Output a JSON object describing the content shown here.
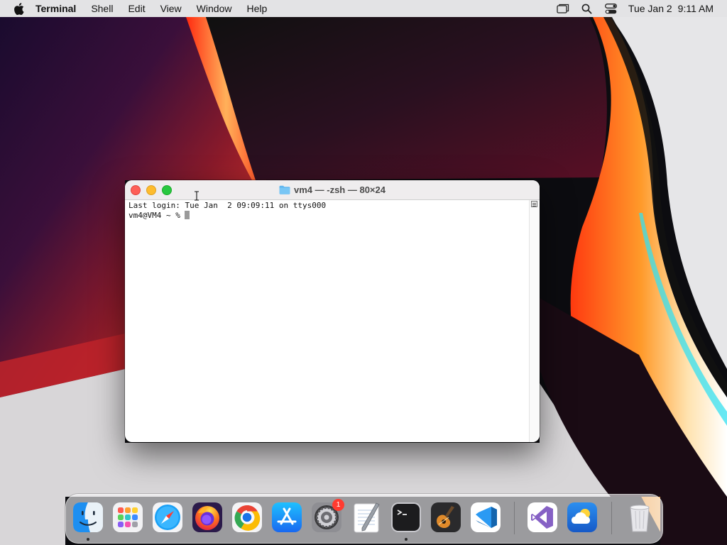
{
  "menubar": {
    "app_name": "Terminal",
    "menus": [
      "Shell",
      "Edit",
      "View",
      "Window",
      "Help"
    ],
    "status_icons": [
      "screen-mirroring-icon",
      "spotlight-search-icon",
      "control-center-icon"
    ],
    "date": "Tue Jan 2",
    "time": "9:11 AM"
  },
  "window": {
    "title": "vm4 — -zsh — 80×24",
    "lines": [
      "Last login: Tue Jan  2 09:09:11 on ttys000",
      "vm4@VM4 ~ % "
    ]
  },
  "dock": {
    "apps": [
      {
        "name": "Finder",
        "icon": "finder-icon",
        "running": true
      },
      {
        "name": "Launchpad",
        "icon": "launchpad-icon",
        "running": false
      },
      {
        "name": "Safari",
        "icon": "safari-icon",
        "running": false
      },
      {
        "name": "Firefox",
        "icon": "firefox-icon",
        "running": false
      },
      {
        "name": "Google Chrome",
        "icon": "chrome-icon",
        "running": false
      },
      {
        "name": "App Store",
        "icon": "app-store-icon",
        "running": false
      },
      {
        "name": "System Settings",
        "icon": "system-settings-icon",
        "running": false,
        "badge": "1"
      },
      {
        "name": "TextEdit",
        "icon": "textedit-icon",
        "running": false
      },
      {
        "name": "Terminal",
        "icon": "terminal-icon",
        "running": true
      },
      {
        "name": "GarageBand",
        "icon": "garageband-icon",
        "running": false
      },
      {
        "name": "Visual Studio Code",
        "icon": "vscode-icon",
        "running": false
      },
      {
        "name": "Visual Studio",
        "icon": "visual-studio-icon",
        "running": false
      },
      {
        "name": "Weather",
        "icon": "weather-icon",
        "running": false
      },
      {
        "name": "Trash",
        "icon": "trash-icon",
        "running": false
      }
    ]
  },
  "colors": {
    "close": "#fe5f57",
    "minimize": "#febc2e",
    "maximize": "#28c840",
    "badge": "#ff3b30"
  }
}
